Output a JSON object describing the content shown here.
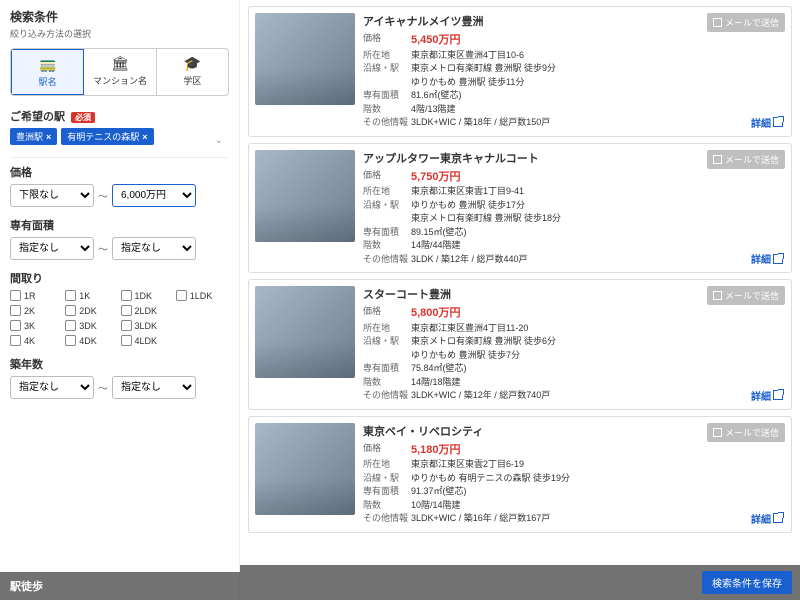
{
  "sidebar": {
    "title": "検索条件",
    "subtitle": "絞り込み方法の選択",
    "tabs": [
      {
        "icon": "🚃",
        "label": "駅名"
      },
      {
        "icon": "🏛",
        "label": "マンション名"
      },
      {
        "icon": "🎓",
        "label": "学区"
      }
    ],
    "station_label": "ご希望の駅",
    "required_label": "必須",
    "station_tags": [
      "豊洲駅",
      "有明テニスの森駅"
    ],
    "price_label": "価格",
    "price_min": "下限なし",
    "price_max": "6,000万円",
    "area_label": "専有面積",
    "area_min": "指定なし",
    "area_max": "指定なし",
    "layout_label": "間取り",
    "layouts": [
      "1R",
      "1K",
      "1DK",
      "1LDK",
      "2K",
      "2DK",
      "2LDK",
      "",
      "3K",
      "3DK",
      "3LDK",
      "",
      "4K",
      "4DK",
      "4LDK",
      ""
    ],
    "age_label": "築年数",
    "age_min": "指定なし",
    "age_max": "指定なし",
    "walk_label": "駅徒歩"
  },
  "listings": [
    {
      "title": "アイキャナルメイツ豊洲",
      "price": "5,450万円",
      "address": "東京都江東区豊洲4丁目10-6",
      "line": "東京メトロ有楽町線 豊洲駅 徒歩9分",
      "line2": "ゆりかもめ 豊洲駅 徒歩11分",
      "area": "81.6㎡(壁芯)",
      "floor": "4階/13階建",
      "other": "3LDK+WIC / 築18年 / 総戸数150戸"
    },
    {
      "title": "アップルタワー東京キャナルコート",
      "price": "5,750万円",
      "address": "東京都江東区東雲1丁目9-41",
      "line": "ゆりかもめ 豊洲駅 徒歩17分",
      "line2": "東京メトロ有楽町線 豊洲駅 徒歩18分",
      "area": "89.15㎡(壁芯)",
      "floor": "14階/44階建",
      "other": "3LDK / 築12年 / 総戸数440戸"
    },
    {
      "title": "スターコート豊洲",
      "price": "5,800万円",
      "address": "東京都江東区豊洲4丁目11-20",
      "line": "東京メトロ有楽町線 豊洲駅 徒歩6分",
      "line2": "ゆりかもめ 豊洲駅 徒歩7分",
      "area": "75.84㎡(壁芯)",
      "floor": "14階/18階建",
      "other": "3LDK+WIC / 築12年 / 総戸数740戸"
    },
    {
      "title": "東京ベイ・リベロシティ",
      "price": "5,180万円",
      "address": "東京都江東区東雲2丁目6-19",
      "line": "ゆりかもめ 有明テニスの森駅 徒歩19分",
      "line2": "",
      "area": "91.37㎡(壁芯)",
      "floor": "10階/14階建",
      "other": "3LDK+WIC / 築16年 / 総戸数167戸"
    }
  ],
  "labels": {
    "price": "価格",
    "address": "所在地",
    "line": "沿線・駅",
    "area": "専有面積",
    "floor": "階数",
    "other": "その他情報",
    "mail": "メールで送信",
    "detail": "詳細",
    "save": "検索条件を保存"
  }
}
